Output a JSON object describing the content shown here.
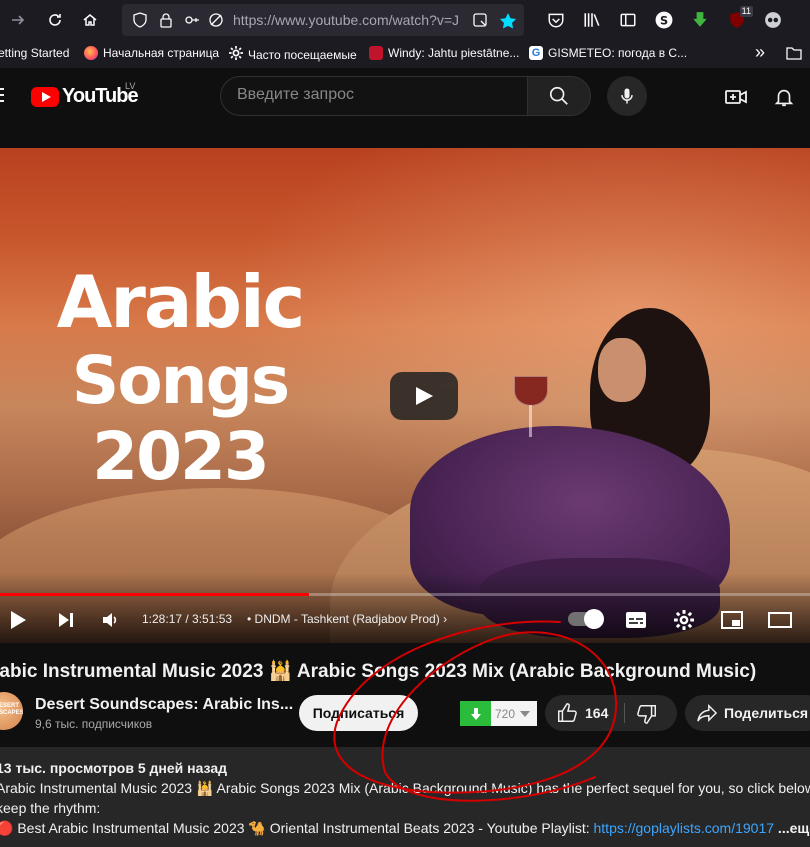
{
  "browser": {
    "url": "https://www.youtube.com/watch?v=J",
    "extension_badge": "11",
    "bookmarks": [
      "etting Started",
      "Начальная страница",
      "Часто посещаемые",
      "Windy: Jahtu piestātne...",
      "GISMETEO: погода в С..."
    ],
    "bookmark_overflow": "»"
  },
  "youtube": {
    "logo_text": "YouTube",
    "country_code": "LV",
    "search_placeholder": "Введите запрос"
  },
  "player": {
    "thumbnail_text": [
      "Arabic",
      "Songs",
      "2023"
    ],
    "time": "1:28:17 / 3:51:53",
    "chapter": "• DNDM - Tashkent (Radjabov Prod)",
    "chapter_arrow": "›",
    "progress": 0.382
  },
  "video": {
    "title": "rabic Instrumental Music 2023 🕌 Arabic Songs 2023 Mix (Arabic Background Music)",
    "channel_name": "Desert Soundscapes: Arabic Ins...",
    "subscribers": "9,6 тыс. подписчиков",
    "subscribe_label": "Подписаться",
    "download_quality": "720",
    "likes": "164",
    "share_label": "Поделиться",
    "avatar_text": "ESERT SCAPES"
  },
  "description": {
    "meta": "13 тыс. просмотров  5 дней назад",
    "line1": "Arabic Instrumental Music 2023 🕌 Arabic Songs 2023 Mix (Arabic Background Music) has the perfect sequel for you, so click below",
    "line2": "keep the rhythm:",
    "line3_prefix": "🔴 Best Arabic Instrumental Music 2023 🐪 Oriental Instrumental Beats 2023 - Youtube Playlist: ",
    "line3_link": "https://goplaylists.com/19017",
    "line3_more": " ...ещё"
  },
  "colors": {
    "yt_red": "#ff0000",
    "link_blue": "#3ea6ff",
    "annotation_red": "#d40000",
    "download_green": "#2bbc3b"
  }
}
